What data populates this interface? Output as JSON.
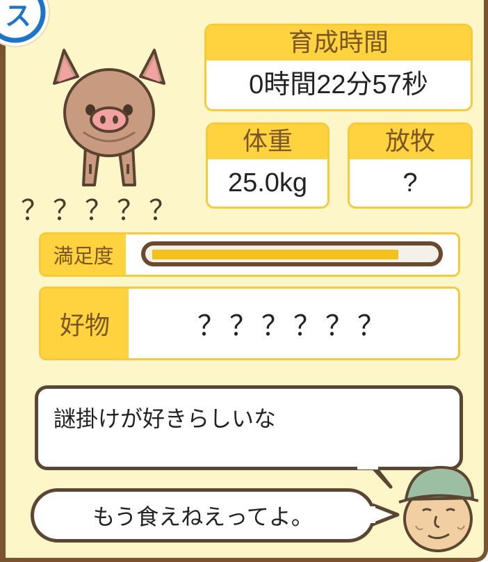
{
  "corner_badge": {
    "glyph": "ス",
    "icon": "blue-circle-badge"
  },
  "pig": {
    "name": "？？？？？",
    "icon": "pig-icon"
  },
  "time_card": {
    "label": "育成時間",
    "value": "0時間22分57秒"
  },
  "weight_card": {
    "label": "体重",
    "value": "25.0kg"
  },
  "grazing_card": {
    "label": "放牧",
    "value": "?"
  },
  "satisfaction": {
    "label": "満足度",
    "level_percent": 88
  },
  "favorite": {
    "label": "好物",
    "value": "？？？？？？"
  },
  "dialogue": {
    "main_text": "謎掛けが好きらしいな",
    "reply_text": "もう食えねえってよ。",
    "speaker_icon": "farmer-face-icon"
  },
  "colors": {
    "panel_bg": "#fdf6c8",
    "header_yellow": "#ffd23f",
    "border_yellow": "#f6cb3a",
    "frame_brown": "#7a5430",
    "bar_fill": "#f6c11a"
  }
}
